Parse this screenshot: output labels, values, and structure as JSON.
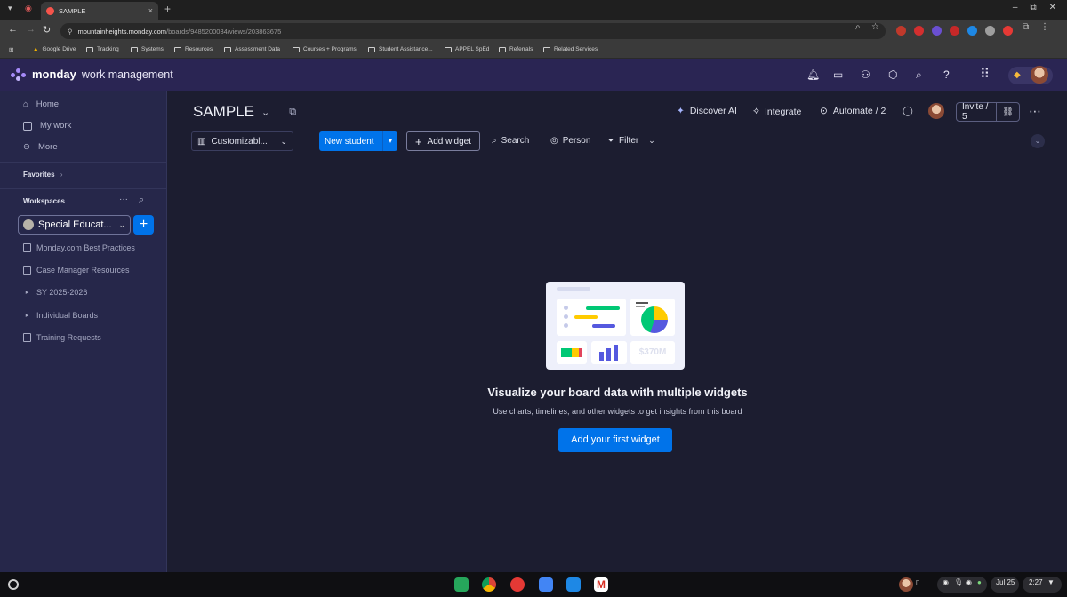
{
  "browser": {
    "tab_title": "SAMPLE",
    "url_host": "mountainheights.monday.com",
    "url_path": "/boards/9485200034/views/203863675",
    "bookmarks": [
      "Google Drive",
      "Tracking",
      "Systems",
      "Resources",
      "Assessment Data",
      "Courses + Programs",
      "Student Assistance...",
      "APPEL SpEd",
      "Referrals",
      "Related Services"
    ]
  },
  "app": {
    "brand": "monday",
    "product": "work management"
  },
  "sidebar": {
    "nav": [
      "Home",
      "My work",
      "More"
    ],
    "favorites_label": "Favorites",
    "workspaces_label": "Workspaces",
    "workspace_name": "Special Educat...",
    "items": [
      {
        "label": "Monday.com Best Practices",
        "kind": "doc"
      },
      {
        "label": "Case Manager Resources",
        "kind": "board"
      },
      {
        "label": "SY 2025-2026",
        "kind": "folder"
      },
      {
        "label": "Individual Boards",
        "kind": "folder"
      },
      {
        "label": "Training Requests",
        "kind": "form"
      }
    ]
  },
  "board": {
    "title": "SAMPLE",
    "discover_ai": "Discover AI",
    "integrate": "Integrate",
    "automate": "Automate / 2",
    "invite": "Invite / 5",
    "view_select": "Customizabl...",
    "new_item": "New student",
    "add_widget": "Add widget",
    "search": "Search",
    "person": "Person",
    "filter": "Filter"
  },
  "empty_state": {
    "title": "Visualize your board data with multiple widgets",
    "subtitle": "Use charts, timelines, and other widgets to get insights from this board",
    "button": "Add your first widget",
    "illustration_number": "$370M"
  },
  "taskbar": {
    "date": "Jul 25",
    "time": "2:27"
  },
  "colors": {
    "accent": "#0073ea",
    "topbar": "#2a2553",
    "sidebar": "#26274a",
    "main_bg": "#1c1d30"
  }
}
